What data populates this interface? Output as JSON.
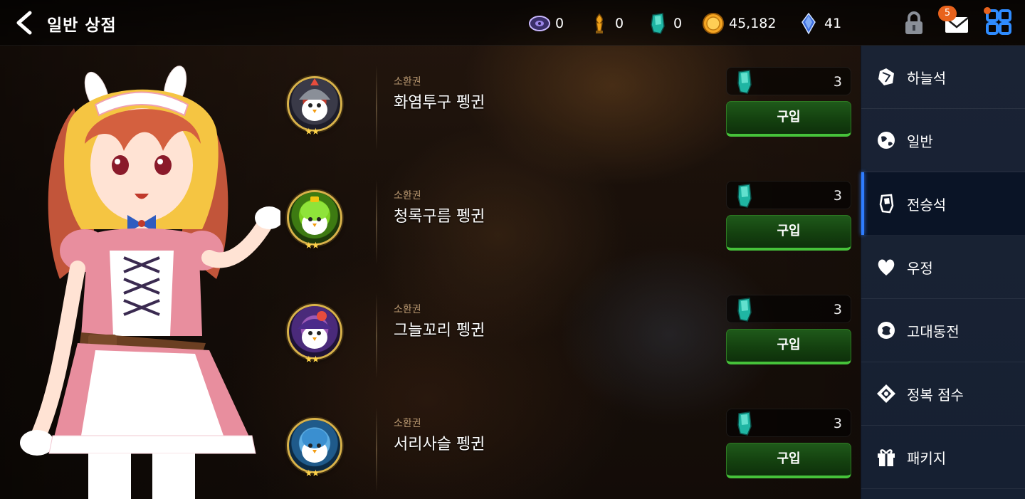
{
  "header": {
    "title": "일반 상점"
  },
  "currencies": [
    {
      "icon": "disc-ticket-icon",
      "value": "0"
    },
    {
      "icon": "torch-trophy-icon",
      "value": "0"
    },
    {
      "icon": "teal-stone-icon",
      "value": "0"
    },
    {
      "icon": "gold-coin-icon",
      "value": "45,182"
    },
    {
      "icon": "blue-crystal-icon",
      "value": "41"
    }
  ],
  "mail_badge": "5",
  "items": [
    {
      "category": "소환권",
      "name": "화염투구 펭귄",
      "price": "3",
      "buy_label": "구입",
      "stars": "★★",
      "color": "#c0392b"
    },
    {
      "category": "소환권",
      "name": "청록구름 펭귄",
      "price": "3",
      "buy_label": "구입",
      "stars": "★★",
      "color": "#7ed321"
    },
    {
      "category": "소환권",
      "name": "그늘꼬리 펭귄",
      "price": "3",
      "buy_label": "구입",
      "stars": "★★",
      "color": "#6a4bc4"
    },
    {
      "category": "소환권",
      "name": "서리사슬 펭귄",
      "price": "3",
      "buy_label": "구입",
      "stars": "★★",
      "color": "#4aa3df"
    }
  ],
  "sidebar": {
    "items": [
      {
        "label": "하늘석",
        "icon": "sky-stone-icon"
      },
      {
        "label": "일반",
        "icon": "globe-icon"
      },
      {
        "label": "전승석",
        "icon": "legacy-stone-icon",
        "active": true
      },
      {
        "label": "우정",
        "icon": "heart-icon"
      },
      {
        "label": "고대동전",
        "icon": "ancient-coin-icon"
      },
      {
        "label": "정복 점수",
        "icon": "conquest-emblem-icon"
      },
      {
        "label": "패키지",
        "icon": "gift-icon"
      }
    ]
  },
  "colors": {
    "buy_button": "#14410f",
    "buy_button_glow": "#46c23a",
    "sidebar_bg": "#1a2334",
    "sidebar_active_accent": "#2f7dff",
    "badge": "#e8621c"
  }
}
